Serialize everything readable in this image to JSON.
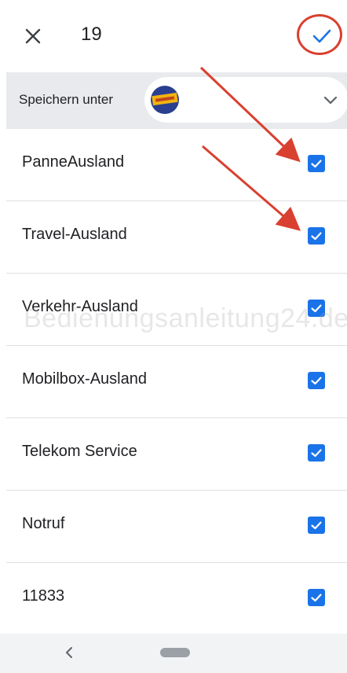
{
  "header": {
    "count": "19",
    "close_icon": "close-icon",
    "confirm_icon": "check-icon"
  },
  "save_bar": {
    "label": "Speichern unter",
    "account_icon": "account-avatar",
    "dropdown_icon": "chevron-down-icon"
  },
  "contacts": [
    {
      "name": "PanneAusland",
      "checked": true
    },
    {
      "name": "Travel-Ausland",
      "checked": true
    },
    {
      "name": "Verkehr-Ausland",
      "checked": true
    },
    {
      "name": "Mobilbox-Ausland",
      "checked": true
    },
    {
      "name": "Telekom Service",
      "checked": true
    },
    {
      "name": "Notruf",
      "checked": true
    },
    {
      "name": "11833",
      "checked": true
    }
  ],
  "watermark": "Bedienungsanleitung24.de",
  "colors": {
    "accent": "#1a73e8",
    "annotation": "#d9402f"
  }
}
